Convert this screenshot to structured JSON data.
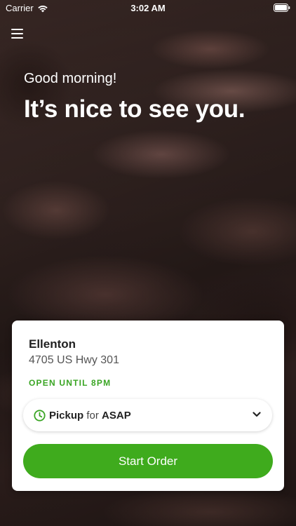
{
  "status_bar": {
    "carrier": "Carrier",
    "time": "3:02 AM",
    "wifi_icon": "wifi-icon",
    "battery_icon": "battery-icon"
  },
  "header": {
    "menu_icon": "hamburger-menu-icon",
    "greeting": "Good morning!",
    "headline": "It’s nice to see you."
  },
  "store_card": {
    "name": "Ellenton",
    "address": "4705 US Hwy 301",
    "hours_status": "OPEN UNTIL 8PM",
    "order_mode": {
      "icon": "clock-icon",
      "method": "Pickup",
      "connector": "for",
      "time": "ASAP",
      "dropdown_icon": "chevron-down-icon"
    },
    "start_button_label": "Start Order"
  },
  "colors": {
    "accent_green": "#3fab1d",
    "hours_green": "#3aa524",
    "card_bg": "#ffffff"
  }
}
